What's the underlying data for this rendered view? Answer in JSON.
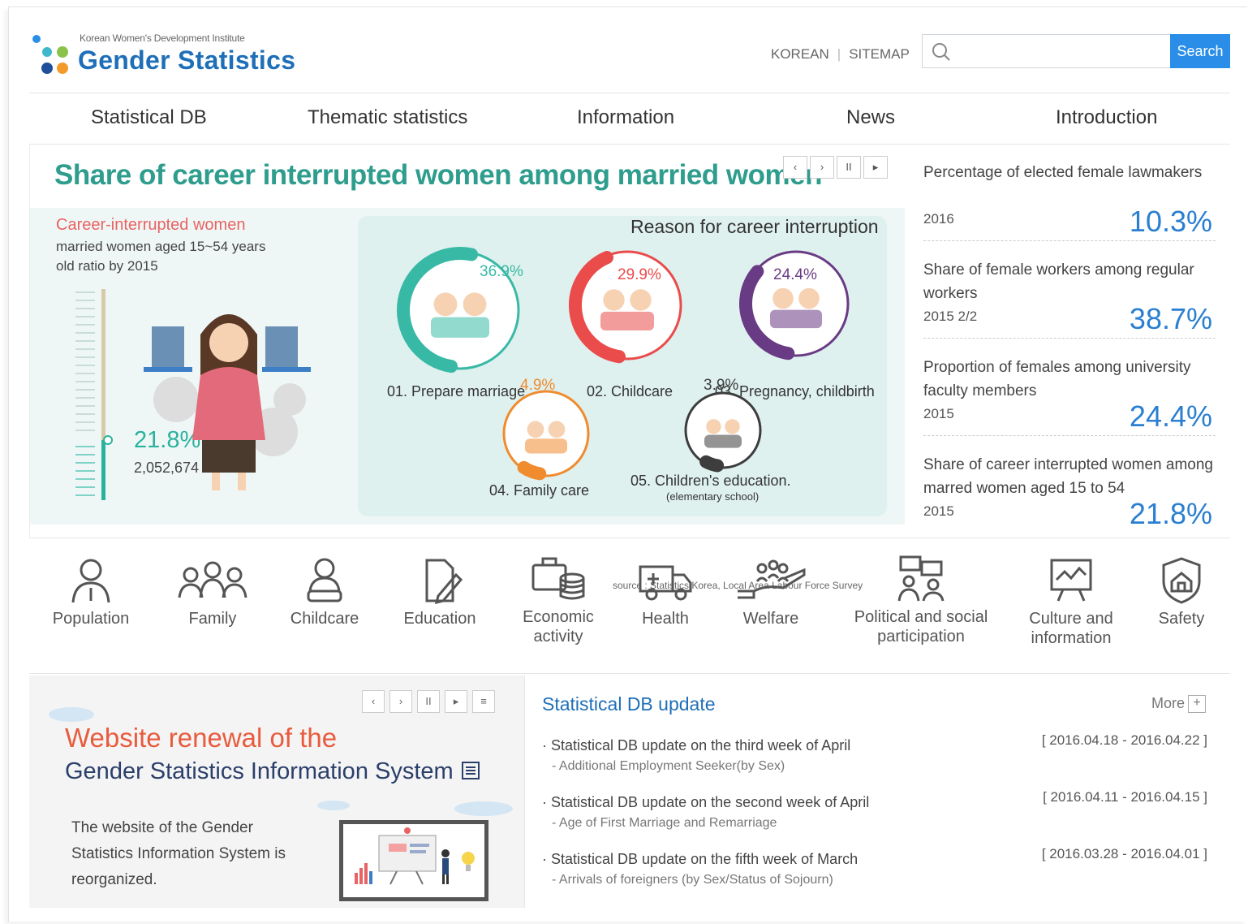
{
  "header": {
    "org_name": "Korean Women's Development Institute",
    "site_title": "Gender Statistics",
    "korean_link": "KOREAN",
    "sitemap_link": "SITEMAP",
    "search_placeholder": "",
    "search_button": "Search"
  },
  "nav": [
    "Statistical DB",
    "Thematic statistics",
    "Information",
    "News",
    "Introduction"
  ],
  "hero": {
    "title": "Share of career interrupted women among married women",
    "controls": [
      "‹",
      "›",
      "II",
      "▸"
    ],
    "left_title": "Career-interrupted women",
    "left_desc": "married women aged 15~54 years old ratio by 2015",
    "big_pct": "21.8%",
    "big_num": "2,052,674",
    "reason_title": "Reason for career interruption",
    "reasons": [
      {
        "pct": "36.9%",
        "label": "01. Prepare marriage",
        "value": 36.9,
        "color": "#38b9a5"
      },
      {
        "pct": "29.9%",
        "label": "02. Childcare",
        "value": 29.9,
        "color": "#ea4b4b"
      },
      {
        "pct": "24.4%",
        "label": "03. Pregnancy, childbirth",
        "value": 24.4,
        "color": "#6a3b85"
      },
      {
        "pct": "4.9%",
        "label": "04. Family care",
        "value": 4.9,
        "color": "#f08b2e"
      },
      {
        "pct": "3.9%",
        "label": "05. Children's education.",
        "sublabel": "(elementary school)",
        "value": 3.9,
        "color": "#3d3d3d"
      }
    ],
    "source": "source : Statistics Korea, Local Area Labour Force Survey"
  },
  "stats": [
    {
      "label": "Percentage of elected female lawmakers",
      "year": "2016",
      "value": "10.3%"
    },
    {
      "label": "Share of female workers among regular workers",
      "year": "2015 2/2",
      "value": "38.7%"
    },
    {
      "label": "Proportion of females among university faculty members",
      "year": "2015",
      "value": "24.4%"
    },
    {
      "label": "Share of career interrupted women among marred women aged 15 to 54",
      "year": "2015",
      "value": "21.8%"
    }
  ],
  "categories": [
    {
      "label": "Population",
      "icon": "person-icon"
    },
    {
      "label": "Family",
      "icon": "family-icon"
    },
    {
      "label": "Childcare",
      "icon": "childcare-icon"
    },
    {
      "label": "Education",
      "icon": "education-icon"
    },
    {
      "label": "Economic activity",
      "icon": "economic-icon"
    },
    {
      "label": "Health",
      "icon": "ambulance-icon"
    },
    {
      "label": "Welfare",
      "icon": "welfare-hand-icon"
    },
    {
      "label": "Political and social participation",
      "icon": "participation-icon"
    },
    {
      "label": "Culture and information",
      "icon": "culture-icon"
    },
    {
      "label": "Safety",
      "icon": "shield-icon"
    }
  ],
  "banner": {
    "controls": [
      "‹",
      "›",
      "II",
      "▸",
      "≡"
    ],
    "title1": "Website renewal of the",
    "title2": "Gender Statistics Information System",
    "desc": "The website of the Gender Statistics Information System is reorganized."
  },
  "updates": {
    "title": "Statistical DB update",
    "more": "More",
    "items": [
      {
        "title": "Statistical DB update on the third week of April",
        "sub": "Additional Employment Seeker(by Sex)",
        "date": "[ 2016.04.18 - 2016.04.22 ]"
      },
      {
        "title": "Statistical DB update on the second week of April",
        "sub": "Age of First Marriage and Remarriage",
        "date": "[ 2016.04.11 - 2016.04.15 ]"
      },
      {
        "title": "Statistical DB update on the fifth week of March",
        "sub": "Arrivals of foreigners (by Sex/Status of Sojourn)",
        "date": "[ 2016.03.28 - 2016.04.01 ]"
      }
    ]
  }
}
